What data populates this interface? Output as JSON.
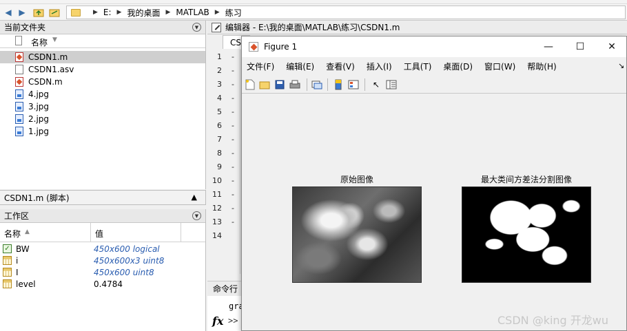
{
  "address_bar": {
    "crumbs": [
      "E:",
      "我的桌面",
      "MATLAB",
      "练习"
    ]
  },
  "current_folder": {
    "title": "当前文件夹",
    "column_name": "名称",
    "files": [
      {
        "name": "CSDN1.m",
        "type": "m",
        "selected": true
      },
      {
        "name": "CSDN1.asv",
        "type": "asv"
      },
      {
        "name": "CSDN.m",
        "type": "m"
      },
      {
        "name": "4.jpg",
        "type": "jpg"
      },
      {
        "name": "3.jpg",
        "type": "jpg"
      },
      {
        "name": "2.jpg",
        "type": "jpg"
      },
      {
        "name": "1.jpg",
        "type": "jpg"
      }
    ]
  },
  "details": {
    "label": "CSDN1.m  (脚本)"
  },
  "workspace": {
    "title": "工作区",
    "col_name": "名称",
    "col_value": "值",
    "vars": [
      {
        "name": "BW",
        "value": "450x600 logical",
        "icon": "check-icon"
      },
      {
        "name": "i",
        "value": "450x600x3 uint8",
        "icon": "grid-icon"
      },
      {
        "name": "I",
        "value": "450x600 uint8",
        "icon": "grid-icon"
      },
      {
        "name": "level",
        "value": "0.4784",
        "icon": "grid-icon"
      }
    ]
  },
  "editor": {
    "title": "编辑器 - E:\\我的桌面\\MATLAB\\练习\\CSDN1.m",
    "tab": "CS",
    "line_numbers": [
      "1",
      "2",
      "3",
      "4",
      "5",
      "6",
      "7",
      "8",
      "9",
      "10",
      "11",
      "12",
      "13",
      "14"
    ],
    "command_title": "命令行",
    "cmd_line": "gra",
    "prompt": ">>",
    "fx": "fx"
  },
  "figure": {
    "title": "Figure 1",
    "menu": [
      "文件(F)",
      "编辑(E)",
      "查看(V)",
      "插入(I)",
      "工具(T)",
      "桌面(D)",
      "窗口(W)",
      "帮助(H)"
    ],
    "image1_title": "原始图像",
    "image2_title": "最大类间方差法分割图像"
  },
  "watermark": "CSDN @king 开龙wu"
}
